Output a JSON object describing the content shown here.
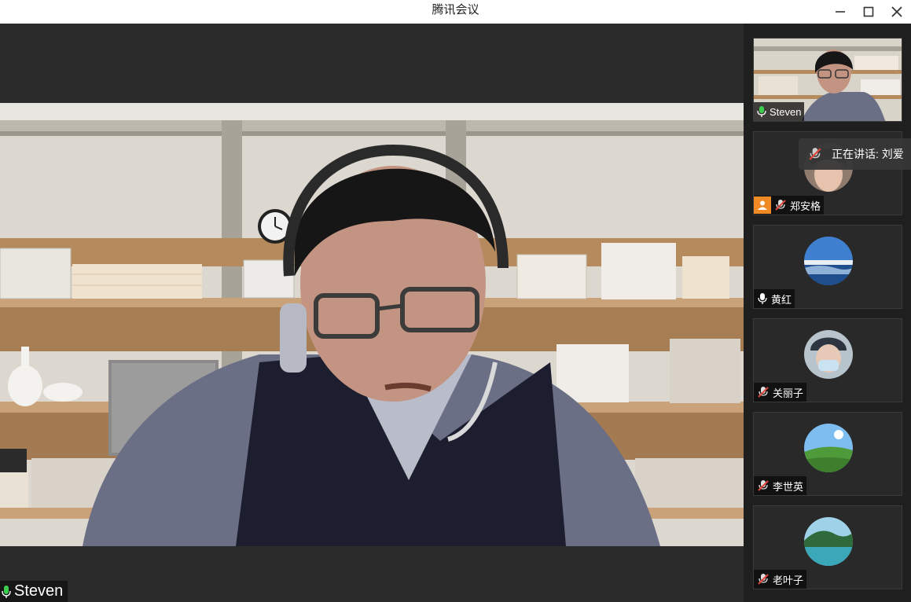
{
  "window": {
    "title": "腾讯会议",
    "minimize_icon": "minimize-icon",
    "maximize_icon": "maximize-icon",
    "close_icon": "close-icon"
  },
  "main_video": {
    "speaker_name": "Steven",
    "mic_state": "active",
    "mic_color": "#3ccf4e"
  },
  "speaking_indicator": {
    "text": "正在讲话: 刘爱",
    "icon": "mic-muted-icon"
  },
  "participants": [
    {
      "name": "Steven",
      "mic": "active",
      "has_video": true
    },
    {
      "name": "郑安格",
      "mic": "muted",
      "host": true
    },
    {
      "name": "黄红",
      "mic": "on"
    },
    {
      "name": "关丽子",
      "mic": "muted"
    },
    {
      "name": "李世英",
      "mic": "muted"
    },
    {
      "name": "老叶子",
      "mic": "muted"
    }
  ],
  "colors": {
    "accent_green": "#3ccf4e",
    "host_orange": "#f08a24",
    "muted_red": "#e0453a"
  }
}
